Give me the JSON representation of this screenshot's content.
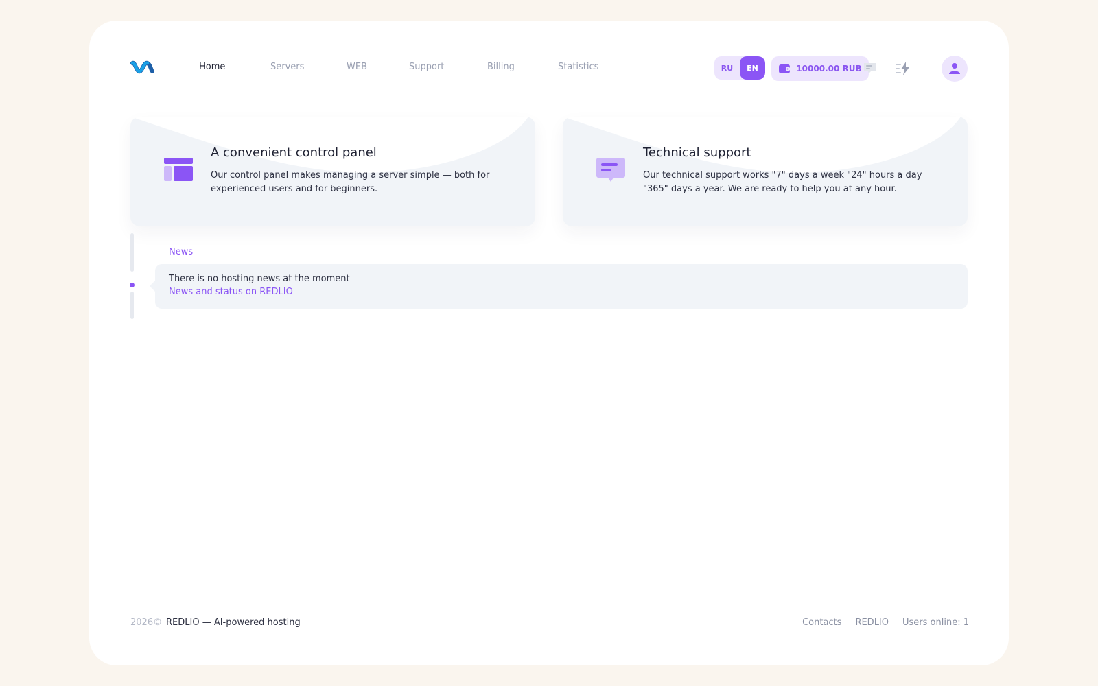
{
  "header": {
    "nav": [
      {
        "label": "Home",
        "active": true
      },
      {
        "label": "Servers",
        "active": false
      },
      {
        "label": "WEB",
        "active": false
      },
      {
        "label": "Support",
        "active": false
      },
      {
        "label": "Billing",
        "active": false
      },
      {
        "label": "Statistics",
        "active": false
      }
    ],
    "lang": {
      "ru": "RU",
      "en": "EN",
      "selected": "EN"
    },
    "balance": "10000.00 RUB",
    "icons": [
      "logo-icon",
      "wallet-icon",
      "chat-icon",
      "activity-icon",
      "user-icon"
    ]
  },
  "cards": [
    {
      "title": "A convenient control panel",
      "text": "Our control panel makes managing a server simple — both for experienced users and for beginners.",
      "icon": "layout-icon"
    },
    {
      "title": "Technical support",
      "text": "Our technical support works \"7\" days a week \"24\" hours a day \"365\" days a year. We are ready to help you at any hour.",
      "icon": "message-icon"
    }
  ],
  "news": {
    "label": "News",
    "message": "There is no hosting news at the moment",
    "link": "News and status on REDLIO"
  },
  "footer": {
    "year": "2026©",
    "brand": "REDLIO — AI-powered hosting",
    "links": [
      "Contacts",
      "REDLIO"
    ],
    "online": "Users online: 1"
  },
  "colors": {
    "accent": "#8b55f5",
    "accent_light": "#ede5fd",
    "page_bg": "#faf5ee",
    "card_bg": "#f1f4f8",
    "logo_blue": "#1aa0e6",
    "logo_dark": "#1d5fa8"
  }
}
